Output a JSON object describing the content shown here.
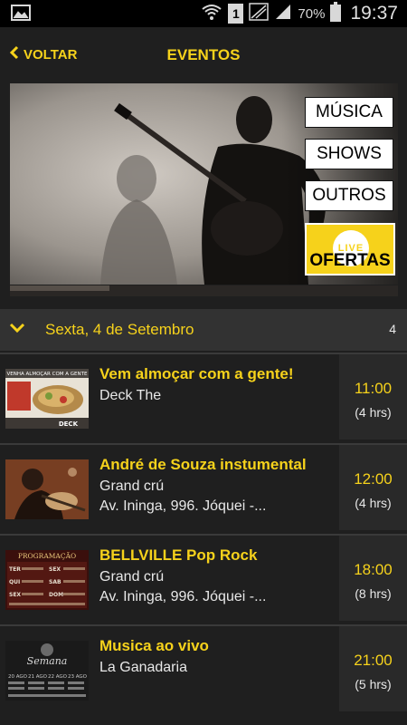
{
  "status_bar": {
    "sim_label": "1",
    "battery": "70%",
    "time": "19:37"
  },
  "header": {
    "back_label": "VOLTAR",
    "title": "EVENTOS"
  },
  "banner": {
    "categories": [
      "MÚSICA",
      "SHOWS",
      "OUTROS"
    ],
    "offers_badge": "LIVE",
    "offers_label": "OFERTAS"
  },
  "date_group": {
    "label": "Sexta, 4 de Setembro",
    "count": "4"
  },
  "events": [
    {
      "title": "Vem almoçar com a gente!",
      "venue": "Deck The",
      "address": "",
      "time": "11:00",
      "duration": "(4 hrs)",
      "thumb_text": [
        "VENHA ALMOÇAR COM A GENTE",
        "DECK"
      ]
    },
    {
      "title": "André de Souza instumental",
      "venue": "Grand crú",
      "address": "Av. Ininga, 996. Jóquei -...",
      "time": "12:00",
      "duration": "(4 hrs)",
      "thumb_text": []
    },
    {
      "title": "BELLVILLE Pop Rock",
      "venue": "Grand crú",
      "address": "Av. Ininga, 996. Jóquei -...",
      "time": "18:00",
      "duration": "(8 hrs)",
      "thumb_text": [
        "PROGRAMAÇÃO",
        "TER",
        "SEX",
        "QUI",
        "SAB",
        "SEX",
        "DOM"
      ]
    },
    {
      "title": "Musica ao vivo",
      "venue": "La Ganadaria",
      "address": "",
      "time": "21:00",
      "duration": "(5 hrs)",
      "thumb_text": [
        "Semana",
        "20 AGO",
        "21 AGO",
        "22 AGO",
        "23 AGO"
      ]
    }
  ],
  "colors": {
    "accent": "#f6d21b",
    "background": "#1f1f1f",
    "date_header": "#323232",
    "time_column": "#292929"
  },
  "icons": {
    "status_left": "image-icon",
    "back": "chevron-left-icon",
    "date_toggle": "chevron-down-icon"
  }
}
